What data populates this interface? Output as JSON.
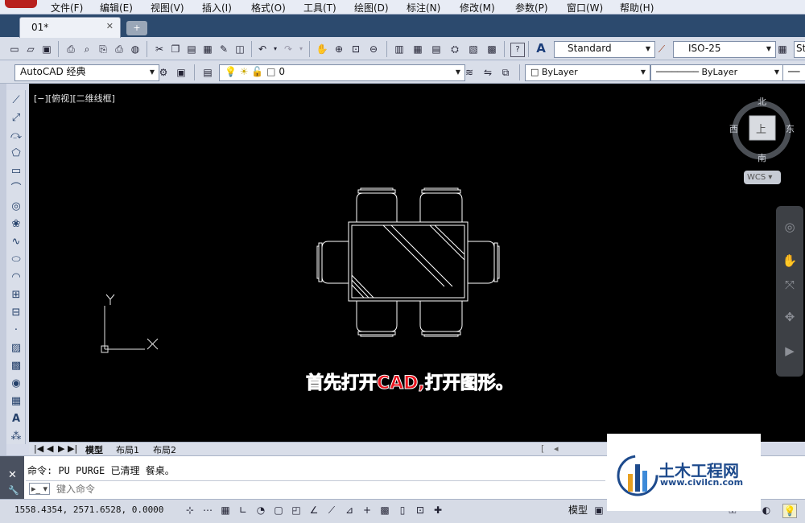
{
  "menu": [
    "文件(F)",
    "编辑(E)",
    "视图(V)",
    "插入(I)",
    "格式(O)",
    "工具(T)",
    "绘图(D)",
    "标注(N)",
    "修改(M)",
    "参数(P)",
    "窗口(W)",
    "帮助(H)"
  ],
  "doc_tab": {
    "title": "01*",
    "close": "✕",
    "new": "+"
  },
  "toolbar1": {
    "text_style": "Standard",
    "dim_style": "ISO-25",
    "table_style_partial": "St"
  },
  "toolbar2": {
    "workspace": "AutoCAD 经典",
    "layer": "0",
    "color": "ByLayer",
    "linetype": "ByLayer"
  },
  "viewport_label": "[−][俯视][二维线框]",
  "viewcube": {
    "north": "北",
    "south": "南",
    "east": "东",
    "west": "西",
    "top": "上",
    "wcs": "WCS"
  },
  "ucs": {
    "x": "X",
    "y": "Y"
  },
  "annotation": "首先打开CAD,打开图形。",
  "layout_tabs": [
    "模型",
    "布局1",
    "布局2"
  ],
  "command": {
    "history": "命令: PU PURGE 已清理 餐桌。",
    "placeholder": "键入命令"
  },
  "status": {
    "coords": "1558.4354, 2571.6528, 0.0000",
    "model": "模型"
  },
  "watermark": {
    "title": "土木工程网",
    "url": "www.civilcn.com"
  },
  "colors": {
    "canvas": "#000000",
    "annotation": "#e8141e",
    "geometry": "#ffffff",
    "brand": "#1d4a8c"
  }
}
